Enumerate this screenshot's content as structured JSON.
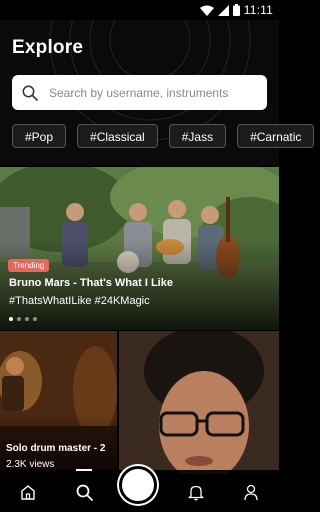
{
  "status_bar": {
    "time": "11:11",
    "icons": [
      "wifi-icon",
      "signal-icon",
      "battery-icon"
    ]
  },
  "header": {
    "title": "Explore"
  },
  "search": {
    "placeholder": "Search by username, instruments",
    "value": ""
  },
  "genre_chips": [
    {
      "label": "#Pop"
    },
    {
      "label": "#Classical"
    },
    {
      "label": "#Jass"
    },
    {
      "label": "#Carnatic"
    }
  ],
  "featured": {
    "badge": "Trending",
    "title": "Bruno Mars - That's What I Like",
    "tags": "#ThatsWhatILike #24KMagic",
    "carousel": {
      "count": 4,
      "active_index": 0
    }
  },
  "video_tiles": [
    {
      "title": "Solo drum master - 2",
      "views": "2.3K views"
    },
    {
      "title": "",
      "views": ""
    }
  ],
  "bottom_nav": {
    "items": [
      "home-icon",
      "search-icon",
      "record-icon",
      "notifications-icon",
      "profile-icon"
    ],
    "active": "search-icon"
  },
  "colors": {
    "accent": "#e8665f",
    "background": "#000000",
    "chip_border": "#555555"
  }
}
